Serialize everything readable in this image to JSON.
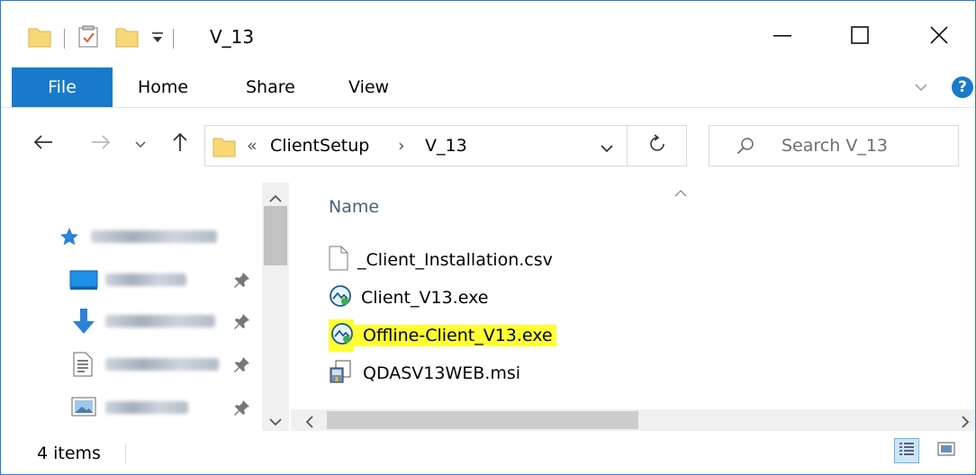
{
  "window": {
    "title": "V_13",
    "min_glyph": "—",
    "max_glyph": "☐",
    "close_glyph": "✕"
  },
  "ribbon": {
    "tabs": [
      {
        "label": "File",
        "active": true
      },
      {
        "label": "Home"
      },
      {
        "label": "Share"
      },
      {
        "label": "View"
      }
    ],
    "help_glyph": "?"
  },
  "address": {
    "overflow": "«",
    "crumbs": [
      "ClientSetup",
      "V_13"
    ],
    "separator": "›"
  },
  "search": {
    "placeholder": "Search V_13"
  },
  "nav_pane": {
    "items": [
      {
        "icon": "star-icon",
        "pinned": false
      },
      {
        "icon": "desktop-icon",
        "pinned": true
      },
      {
        "icon": "download-icon",
        "pinned": true
      },
      {
        "icon": "documents-icon",
        "pinned": true
      },
      {
        "icon": "pictures-icon",
        "pinned": true
      }
    ]
  },
  "file_list": {
    "column_name": "Name",
    "files": [
      {
        "name": "_Client_Installation.csv",
        "icon": "blank-file-icon",
        "highlighted": false
      },
      {
        "name": "Client_V13.exe",
        "icon": "app-globe-icon",
        "highlighted": false
      },
      {
        "name": "Offline-Client_V13.exe",
        "icon": "app-globe-icon",
        "highlighted": true
      },
      {
        "name": "QDASV13WEB.msi",
        "icon": "installer-icon",
        "highlighted": false
      }
    ]
  },
  "status": {
    "item_count": "4 items"
  },
  "colors": {
    "accent": "#1979ca",
    "highlight": "#ffff33",
    "folder": "#f8d775"
  }
}
